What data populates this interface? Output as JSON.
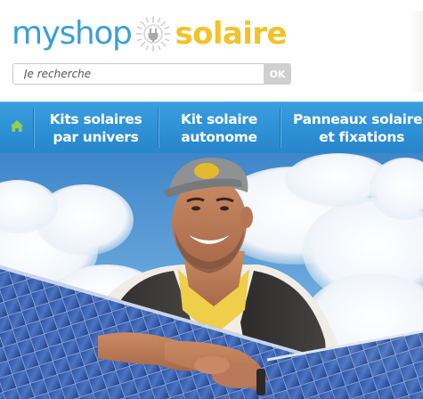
{
  "logo": {
    "part1": "myshop",
    "part2": "solaire",
    "sun_icon": "sun-plug-icon",
    "colors": {
      "blue": "#3d9fd6",
      "yellow": "#f2c227"
    }
  },
  "search": {
    "placeholder": "Je recherche",
    "button_label": "OK"
  },
  "nav": {
    "home_icon": "home-icon",
    "items": [
      {
        "label": "Kits solaires par univers"
      },
      {
        "label": "Kit solaire autonome"
      },
      {
        "label": "Panneaux solaires et fixations"
      }
    ],
    "colors": {
      "bar": "#2d8fd4",
      "home_icon": "#8fd14f"
    }
  },
  "hero": {
    "image": "smiling-man-leaning-on-solar-panel-under-cloudy-sky"
  }
}
